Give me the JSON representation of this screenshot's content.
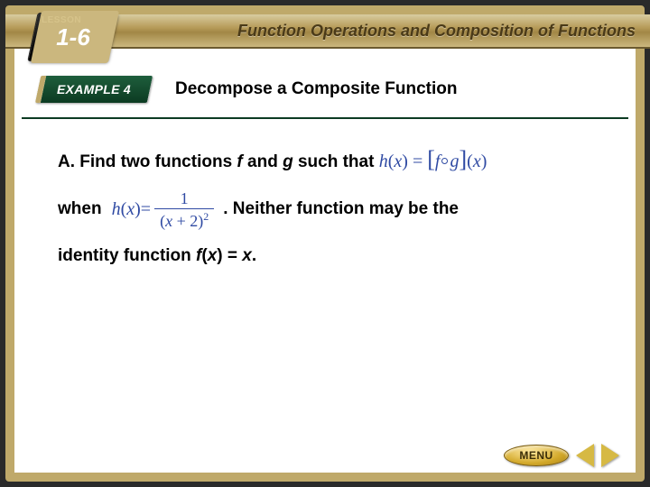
{
  "header": {
    "lesson_word": "LESSON",
    "lesson_number": "1-6",
    "chapter_title": "Function Operations and Composition of Functions"
  },
  "example": {
    "badge_label": "EXAMPLE 4",
    "title": "Decompose a Composite Function"
  },
  "body": {
    "part_label": "A.",
    "line1_a": "Find two functions ",
    "f_var": "f",
    "line1_b": " and ",
    "g_var": "g",
    "line1_c": " such that ",
    "hx_lhs": "h",
    "hx_paren_open": "(",
    "hx_x": "x",
    "hx_paren_close": ")",
    "eq": " = ",
    "bracket_open": "[",
    "compose_f": "f",
    "compose_g": "g",
    "bracket_close": "]",
    "when_word": "when",
    "frac_num": "1",
    "frac_den_open": "(",
    "frac_den_x": "x",
    "frac_den_plus": " + 2",
    "frac_den_close": ")",
    "frac_den_exp": "2",
    "line2_tail": ". Neither function may be the",
    "line3_a": "identity function ",
    "identity_fn": "f",
    "identity_paren_open": "(",
    "identity_x": "x",
    "identity_paren_close": ")",
    "identity_eq": " = ",
    "identity_rhs": "x",
    "line3_end": "."
  },
  "nav": {
    "menu_label": "MENU"
  },
  "chart_data": null
}
